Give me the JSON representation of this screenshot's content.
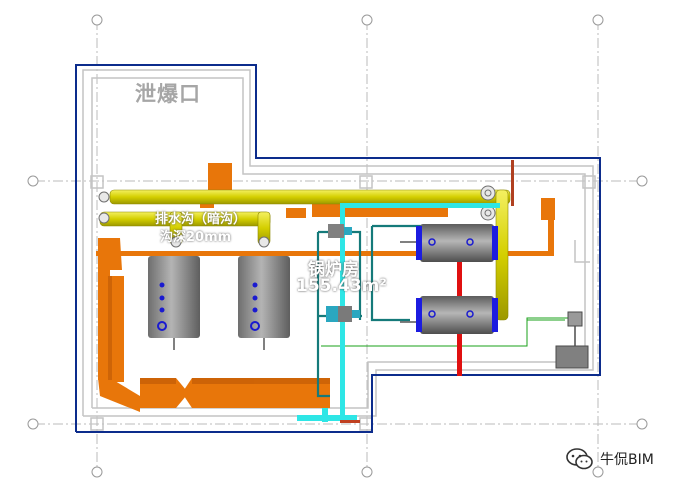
{
  "labels": {
    "explosion_vent": "泄爆口",
    "drain_trench": "排水沟（暗沟）",
    "trench_depth": "沟深20mm",
    "boiler_room": "锅炉房",
    "room_area": "155.43m²"
  },
  "watermark": {
    "text": "牛侃BIM",
    "icon": "wechat-icon"
  },
  "colors": {
    "flue_duct": "#e8760a",
    "gas_pipe": "#d8d400",
    "cold_water_pipe": "#2ee6e6",
    "hot_water_pipe": "#e01010",
    "tank": "#8c8c8c",
    "wall_outline": "#0c2c8c",
    "grid_line": "#bbbbbb"
  }
}
